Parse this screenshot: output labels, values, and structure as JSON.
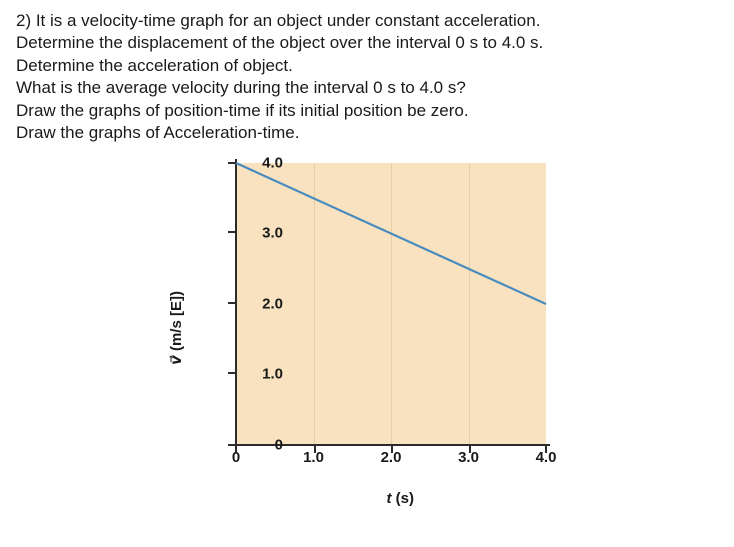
{
  "question": {
    "lines": [
      "2) It is a velocity-time graph for an object under constant acceleration.",
      "Determine the displacement of the object over the interval 0 s to 4.0 s.",
      "Determine the acceleration of object.",
      "What is the average velocity during the interval 0 s to 4.0 s?",
      "Draw the graphs of position-time if its initial position be zero.",
      "Draw the graphs of Acceleration-time."
    ]
  },
  "chart_data": {
    "type": "line",
    "title": "",
    "xlabel_var": "t",
    "xlabel_units": " (s)",
    "ylabel_var": "v⃗",
    "ylabel_units": " (m/s [E])",
    "xlim": [
      0,
      4.0
    ],
    "ylim": [
      0,
      4.0
    ],
    "xticks": [
      0,
      1.0,
      2.0,
      3.0,
      4.0
    ],
    "yticks": [
      0,
      1.0,
      2.0,
      3.0,
      4.0
    ],
    "xtick_labels": [
      "0",
      "1.0",
      "2.0",
      "3.0",
      "4.0"
    ],
    "ytick_labels": [
      "0",
      "1.0",
      "2.0",
      "3.0",
      "4.0"
    ],
    "grid_x": true,
    "grid_y": false,
    "series": [
      {
        "name": "velocity",
        "x": [
          0,
          4.0
        ],
        "y": [
          4.0,
          2.0
        ],
        "color": "#4a8bbf"
      }
    ]
  }
}
